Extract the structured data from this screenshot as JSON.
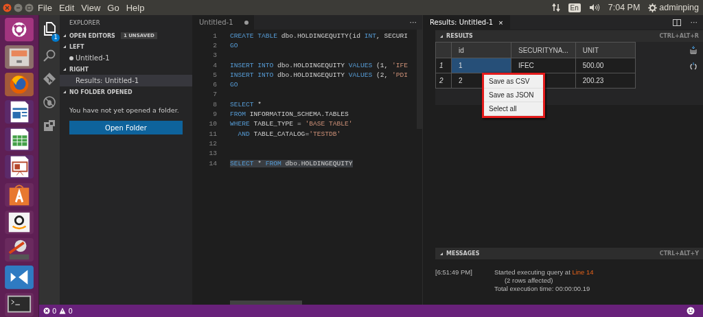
{
  "top_bar": {
    "menu": [
      "File",
      "Edit",
      "View",
      "Go",
      "Help"
    ],
    "keyboard": "En",
    "time": "7:04 PM",
    "user": "adminping"
  },
  "activity_bar": {
    "files_badge": "1"
  },
  "sidebar": {
    "title": "EXPLORER",
    "sections": [
      {
        "label": "OPEN EDITORS",
        "badge": "1 UNSAVED"
      },
      {
        "label": "LEFT",
        "items": [
          {
            "label": "Untitled-1",
            "dirty": true,
            "selected": false
          }
        ]
      },
      {
        "label": "RIGHT",
        "items": [
          {
            "label": "Results: Untitled-1",
            "dirty": false,
            "selected": true
          }
        ]
      },
      {
        "label": "NO FOLDER OPENED",
        "message": "You have not yet opened a folder.",
        "button": "Open Folder"
      }
    ]
  },
  "editor": {
    "tab": {
      "label": "Untitled-1",
      "dirty": true
    },
    "more": "···",
    "lines": [
      {
        "number": "1",
        "tokens": [
          {
            "kind": "keyword",
            "text": "CREATE TABLE"
          },
          {
            "kind": "plain",
            "text": " dbo.HOLDINGEQUITY(id "
          },
          {
            "kind": "keyword",
            "text": "INT"
          },
          {
            "kind": "plain",
            "text": ", SECURI"
          }
        ]
      },
      {
        "number": "2",
        "tokens": [
          {
            "kind": "keyword",
            "text": "GO"
          }
        ]
      },
      {
        "number": "3"
      },
      {
        "number": "4",
        "tokens": [
          {
            "kind": "keyword",
            "text": "INSERT INTO"
          },
          {
            "kind": "plain",
            "text": " dbo.HOLDINGEQUITY "
          },
          {
            "kind": "keyword",
            "text": "VALUES"
          },
          {
            "kind": "plain",
            "text": " (1, "
          },
          {
            "kind": "string",
            "text": "'IFE"
          }
        ]
      },
      {
        "number": "5",
        "tokens": [
          {
            "kind": "keyword",
            "text": "INSERT INTO"
          },
          {
            "kind": "plain",
            "text": " dbo.HOLDINGEQUITY "
          },
          {
            "kind": "keyword",
            "text": "VALUES"
          },
          {
            "kind": "plain",
            "text": " (2, "
          },
          {
            "kind": "string",
            "text": "'PDI"
          }
        ]
      },
      {
        "number": "6",
        "tokens": [
          {
            "kind": "keyword",
            "text": "GO"
          }
        ]
      },
      {
        "number": "7"
      },
      {
        "number": "8",
        "tokens": [
          {
            "kind": "keyword",
            "text": "SELECT"
          },
          {
            "kind": "plain",
            "text": " *"
          }
        ]
      },
      {
        "number": "9",
        "tokens": [
          {
            "kind": "keyword",
            "text": "FROM"
          },
          {
            "kind": "plain",
            "text": " INFORMATION_SCHEMA.TABLES"
          }
        ]
      },
      {
        "number": "10",
        "tokens": [
          {
            "kind": "keyword",
            "text": "WHERE"
          },
          {
            "kind": "plain",
            "text": " TABLE_TYPE = "
          },
          {
            "kind": "string",
            "text": "'BASE TABLE'"
          }
        ]
      },
      {
        "number": "11",
        "indent": true,
        "tokens": [
          {
            "kind": "keyword",
            "text": "AND"
          },
          {
            "kind": "plain",
            "text": " TABLE_CATALOG="
          },
          {
            "kind": "string",
            "text": "'TESTDB'"
          }
        ]
      },
      {
        "number": "12"
      },
      {
        "number": "13"
      },
      {
        "number": "14",
        "tokens": [
          {
            "kind": "keyword",
            "text": "SELECT"
          },
          {
            "kind": "plain",
            "text": " * "
          },
          {
            "kind": "keyword",
            "text": "FROM"
          },
          {
            "kind": "plain",
            "text": " dbo.HOLDINGEQUITY"
          }
        ],
        "selected": true
      }
    ]
  },
  "results": {
    "tab": "Results: Untitled-1",
    "close": "×",
    "more": "···",
    "results_header": {
      "label": "RESULTS",
      "shortcut": "CTRL+ALT+R"
    },
    "columns": [
      "id",
      "SECURITYNA...",
      "UNIT"
    ],
    "rows": [
      {
        "number": "1",
        "cells": [
          {
            "text": "1",
            "selected": true
          },
          {
            "text": "IFEC",
            "selected": false
          },
          {
            "text": "500.00",
            "selected": false
          }
        ]
      },
      {
        "number": "2",
        "cells": [
          {
            "text": "2",
            "selected": false
          },
          {
            "selected": false
          },
          {
            "text": "200.23",
            "selected": false
          }
        ]
      }
    ],
    "context_menu": [
      "Save as CSV",
      "Save as JSON",
      "Select all"
    ],
    "messages_header": {
      "label": "MESSAGES",
      "shortcut": "CTRL+ALT+Y"
    },
    "messages": [
      {
        "time": "[6:51:49 PM]",
        "text": "Started executing query at ",
        "link": "Line 14",
        "details": [
          "(2 rows affected)",
          "Total execution time: 00:00:00.19"
        ]
      }
    ]
  },
  "status_bar": {
    "errors": "0",
    "warnings": "0"
  }
}
